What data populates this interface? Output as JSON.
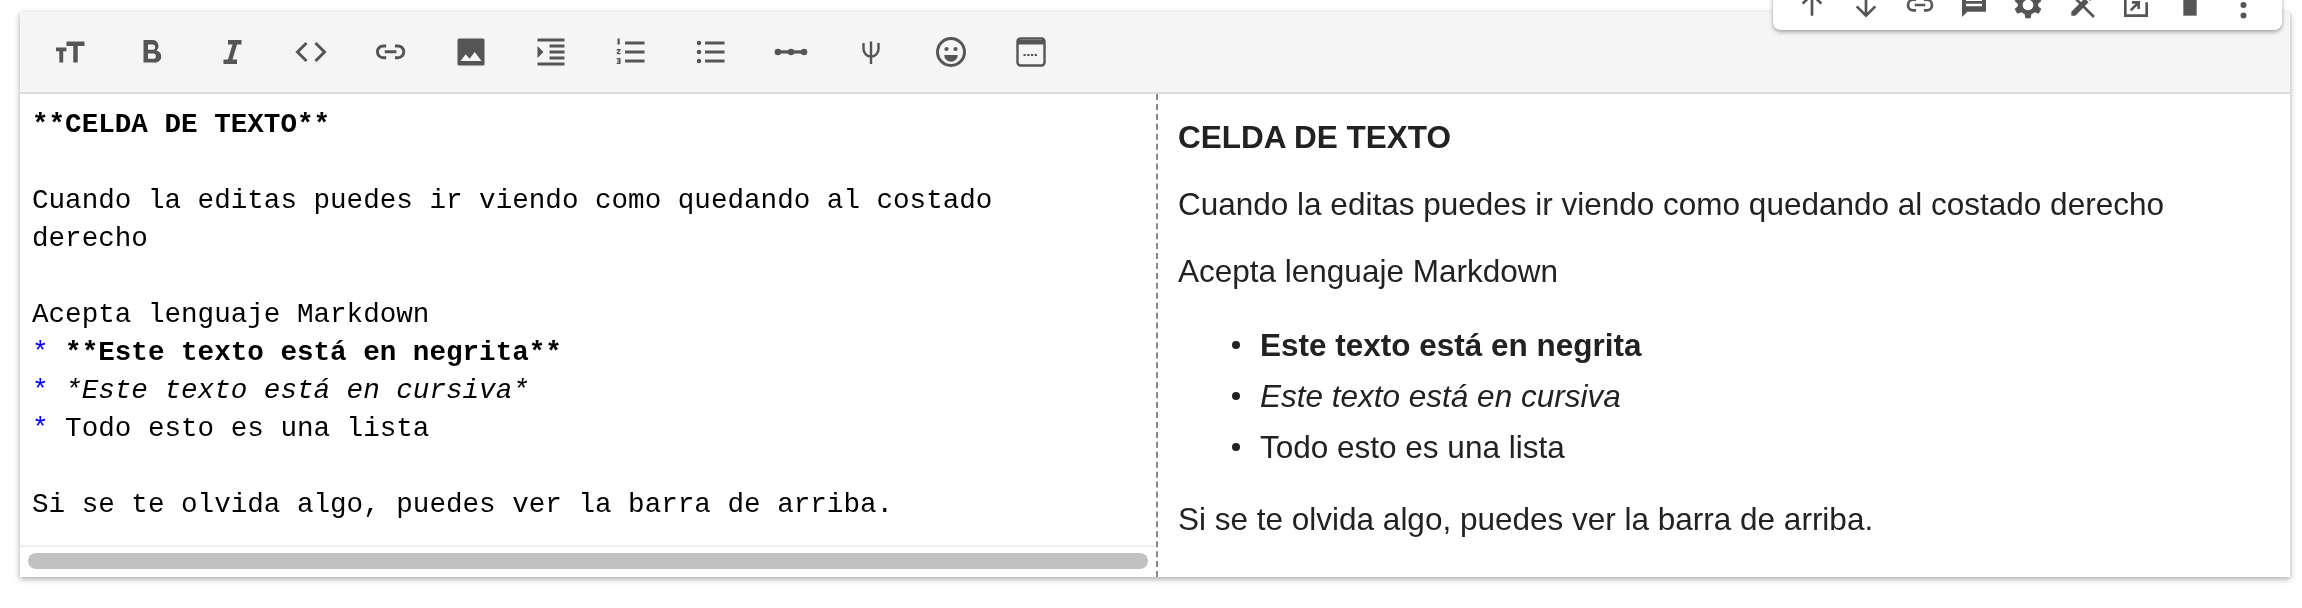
{
  "editor": {
    "lines": [
      {
        "kind": "bold",
        "text": "**CELDA DE TEXTO**"
      },
      {
        "kind": "blank"
      },
      {
        "kind": "plain",
        "text": "Cuando la editas puedes ir viendo como quedando al costado derecho"
      },
      {
        "kind": "blank"
      },
      {
        "kind": "plain",
        "text": "Acepta lenguaje Markdown"
      },
      {
        "kind": "bullet-bold",
        "marker": "*",
        "text": "**Este texto está en negrita**"
      },
      {
        "kind": "bullet-italic",
        "marker": "*",
        "text": "*Este texto está en cursiva*"
      },
      {
        "kind": "bullet-plain",
        "marker": "*",
        "text": "Todo esto es una lista"
      },
      {
        "kind": "blank"
      },
      {
        "kind": "plain",
        "text": "Si se te olvida algo, puedes ver la barra de arriba."
      }
    ]
  },
  "preview": {
    "blocks": [
      {
        "kind": "heading",
        "text": "CELDA DE TEXTO"
      },
      {
        "kind": "paragraph",
        "text": "Cuando la editas puedes ir viendo como quedando al costado derecho"
      },
      {
        "kind": "paragraph",
        "text": "Acepta lenguaje Markdown"
      },
      {
        "kind": "list",
        "items": [
          {
            "kind": "bold",
            "text": "Este texto está en negrita"
          },
          {
            "kind": "italic",
            "text": "Este texto está en cursiva"
          },
          {
            "kind": "plain",
            "text": "Todo esto es una lista"
          }
        ]
      },
      {
        "kind": "paragraph",
        "text": "Si se te olvida algo, puedes ver la barra de arriba."
      }
    ]
  }
}
